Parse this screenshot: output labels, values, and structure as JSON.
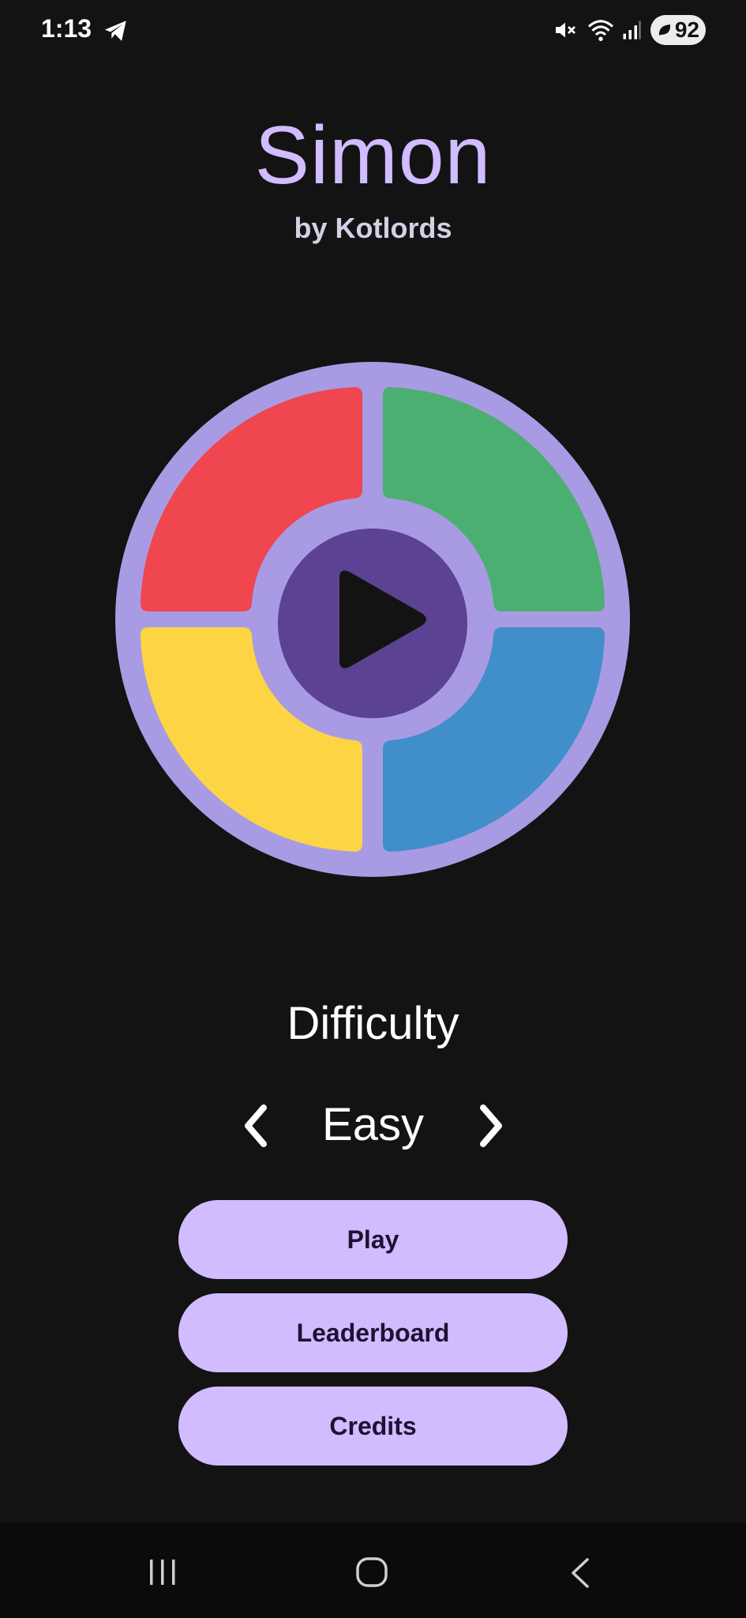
{
  "status_bar": {
    "time": "1:13",
    "battery": "92",
    "icons": [
      "telegram-icon",
      "mute-icon",
      "wifi-icon",
      "signal-icon",
      "battery-icon"
    ]
  },
  "header": {
    "title": "Simon",
    "subtitle": "by Kotlords"
  },
  "board": {
    "colors": {
      "ring": "#a99be3",
      "red": "#ef4650",
      "green": "#4caf72",
      "yellow": "#fdd544",
      "blue": "#418fca",
      "center": "#5c4292",
      "play_glyph": "#131313"
    },
    "center_icon": "play-icon"
  },
  "difficulty": {
    "label": "Difficulty",
    "value": "Easy",
    "prev_icon": "chevron-left-icon",
    "next_icon": "chevron-right-icon"
  },
  "menu": {
    "play_label": "Play",
    "leaderboard_label": "Leaderboard",
    "credits_label": "Credits",
    "button_color": "#d0bcff"
  },
  "nav_bar": {
    "icons": [
      "recents-icon",
      "home-icon",
      "back-icon"
    ]
  }
}
